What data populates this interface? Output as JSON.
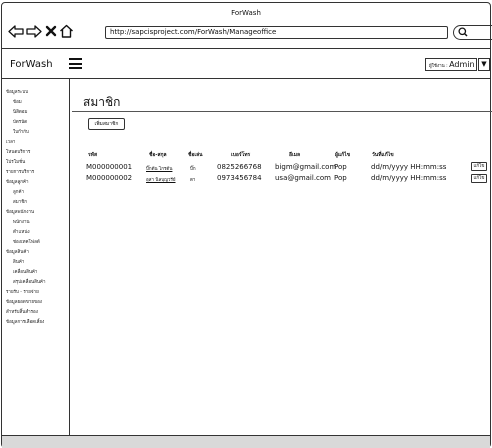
{
  "window": {
    "title": "ForWash"
  },
  "browser": {
    "url": "http://sapcisproject.com/ForWash/Manageoffice"
  },
  "app": {
    "brand": "ForWash",
    "user_prefix": "ผู้ใช้งาน : ",
    "user_name": "Admin"
  },
  "sidebar": {
    "items": [
      "ข้อมูลระบบ",
      "ข้อม",
      "นิสิตอม",
      "บัตรนัด",
      "ใบกำกับ",
      "เวลา",
      "โหนดบริการ",
      "โปรโมชั่น",
      "รายการบริการ",
      "ข้อมูลลูกค้า",
      "ลูกค้า",
      "สมาชิก",
      "ข้อมูลพนักงาน",
      "พนักงาน",
      "ตำแหน่ง",
      "ช่องเทคโฟลด์",
      "ข้อมูลสินค้า",
      "สินค้า",
      "เคลื่อนสินค้า",
      "สรุปเคลื่อนสินค้า",
      "รายรับ - รายจ่าย",
      "ข้อมูลยอดขายของ",
      "สำหรับสิ้นสำรอง",
      "ข้อมูลการเลือดเลี้ยง"
    ]
  },
  "main": {
    "title": "สมาชิก",
    "add_button": "เพิ่มสมาชิก",
    "columns": [
      "รหัส",
      "ชื่อ-สกุล",
      "ชื่อเล่น",
      "เบอร์โทร",
      "อีเมล",
      "ผู้แก้ไข",
      "วันที่แก้ไข"
    ],
    "rows": [
      {
        "id": "M000000001",
        "name": "บิ๊กต้น ไกรต้น",
        "nickname": "บิ๊ก",
        "phone": "0825266768",
        "email": "bigm@gmail.com",
        "editor": "Pop",
        "edited_at": "dd/m/yyyy HH:mm:ss",
        "action": "แก้ไข"
      },
      {
        "id": "M000000002",
        "name": "อุสา นิลบุญวรีย์",
        "nickname": "ตา",
        "phone": "0973456784",
        "email": "usa@gmail.com",
        "editor": "Pop",
        "edited_at": "dd/m/yyyy HH:mm:ss",
        "action": "แก้ไข"
      }
    ]
  },
  "icons": {
    "back": "arrow-left-icon",
    "forward": "arrow-right-icon",
    "close": "close-icon",
    "home": "home-icon",
    "search": "search-icon",
    "menu": "hamburger-menu-icon",
    "dropdown": "chevron-down-icon"
  }
}
